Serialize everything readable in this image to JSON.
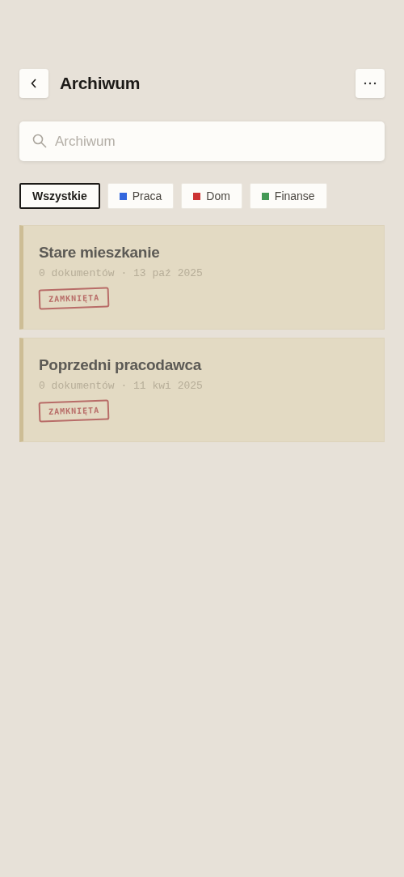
{
  "header": {
    "title": "Archiwum"
  },
  "search": {
    "placeholder": "Archiwum"
  },
  "filters": [
    {
      "label": "Wszystkie",
      "selected": true
    },
    {
      "label": "Praca",
      "selected": false,
      "color": "#3366dd"
    },
    {
      "label": "Dom",
      "selected": false,
      "color": "#cc3333"
    },
    {
      "label": "Finanse",
      "selected": false,
      "color": "#449955"
    }
  ],
  "folders": [
    {
      "name": "Stare mieszkanie",
      "meta": "0 dokumentów · 13 paź 2025",
      "stamp": "ZAMKNIĘTA"
    },
    {
      "name": "Poprzedni pracodawca",
      "meta": "0 dokumentów · 11 kwi 2025",
      "stamp": "ZAMKNIĘTA"
    }
  ]
}
